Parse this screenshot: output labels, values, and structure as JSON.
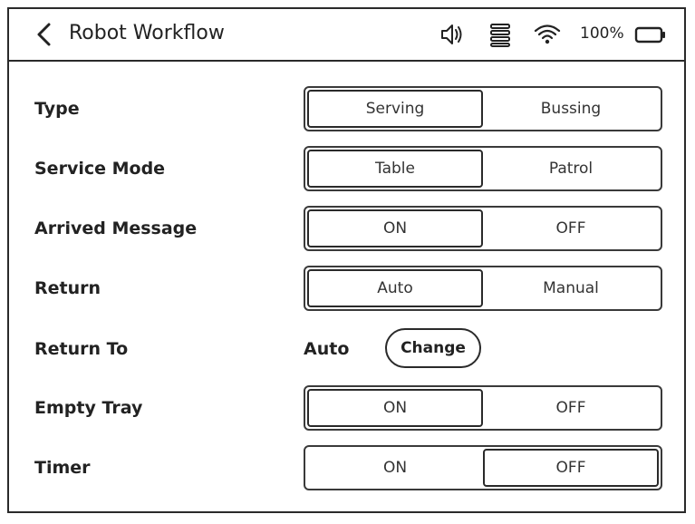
{
  "header": {
    "title": "Robot Workflow",
    "battery": "100%",
    "icons": [
      "back-icon",
      "speaker-icon",
      "list-icon",
      "wifi-icon",
      "battery-icon"
    ]
  },
  "settings": {
    "type": {
      "label": "Type",
      "options": [
        "Serving",
        "Bussing"
      ],
      "selected": "Serving"
    },
    "service_mode": {
      "label": "Service Mode",
      "options": [
        "Table",
        "Patrol"
      ],
      "selected": "Table"
    },
    "arrived_message": {
      "label": "Arrived Message",
      "options": [
        "ON",
        "OFF"
      ],
      "selected": "ON"
    },
    "return": {
      "label": "Return",
      "options": [
        "Auto",
        "Manual"
      ],
      "selected": "Auto"
    },
    "return_to": {
      "label": "Return To",
      "value": "Auto",
      "button_label": "Change"
    },
    "empty_tray": {
      "label": "Empty Tray",
      "options": [
        "ON",
        "OFF"
      ],
      "selected": "ON"
    },
    "timer": {
      "label": "Timer",
      "options": [
        "ON",
        "OFF"
      ],
      "selected": "OFF"
    }
  },
  "colors": {
    "border": "#2a2a2a",
    "text": "#222222",
    "background": "#ffffff"
  }
}
